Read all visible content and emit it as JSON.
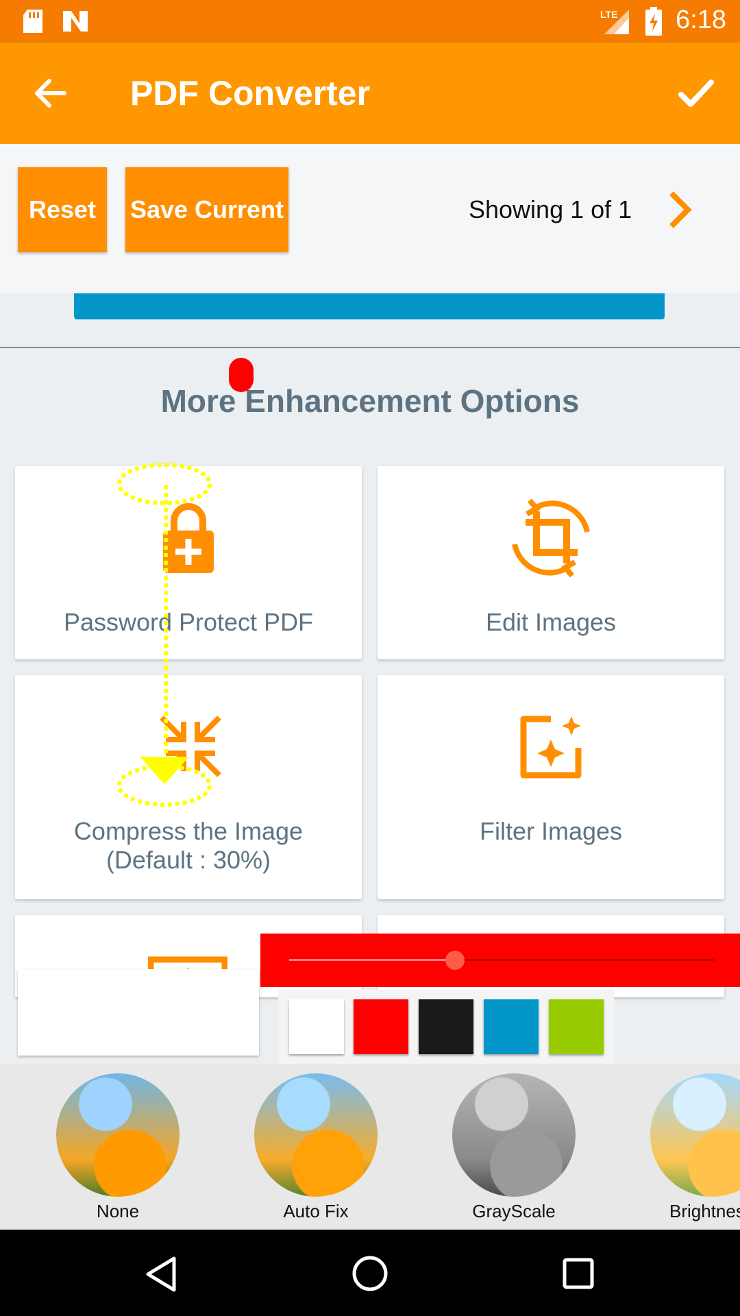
{
  "status_bar": {
    "time": "6:18",
    "network": "LTE",
    "icons": [
      "sd-card-icon",
      "n-notification-icon",
      "lte-signal-icon",
      "battery-charging-icon"
    ]
  },
  "toolbar": {
    "title": "PDF Converter",
    "back_icon": "arrow-back-icon",
    "confirm_icon": "checkmark-icon"
  },
  "controls": {
    "reset_label": "Reset",
    "save_current_label": "Save Current",
    "showing_text": "Showing 1 of 1",
    "next_icon": "chevron-right-icon"
  },
  "enhancement": {
    "heading": "More Enhancement Options",
    "cards": [
      {
        "label": "Password Protect PDF",
        "icon": "lock-add-icon"
      },
      {
        "label": "Edit Images",
        "icon": "crop-rotate-icon"
      },
      {
        "label_line1": "Compress the Image",
        "label_line2": "(Default : 30%)",
        "icon": "compress-arrows-icon"
      },
      {
        "label": "Filter Images",
        "icon": "image-sparkle-icon"
      }
    ]
  },
  "brush": {
    "slider_value": 0.39,
    "colors": [
      "#ffffff",
      "#ff0000",
      "#1a1a1a",
      "#0296c9",
      "#99cc00"
    ]
  },
  "filters": [
    {
      "name": "None"
    },
    {
      "name": "Auto Fix"
    },
    {
      "name": "GrayScale"
    },
    {
      "name": "Brightness"
    }
  ],
  "navigation": {
    "back": "nav-back-icon",
    "home": "nav-home-icon",
    "recents": "nav-recents-icon"
  },
  "colors": {
    "accent": "#ff9800",
    "status_bar": "#f57c00",
    "text_secondary": "#5d7382",
    "blue": "#0296c9"
  }
}
